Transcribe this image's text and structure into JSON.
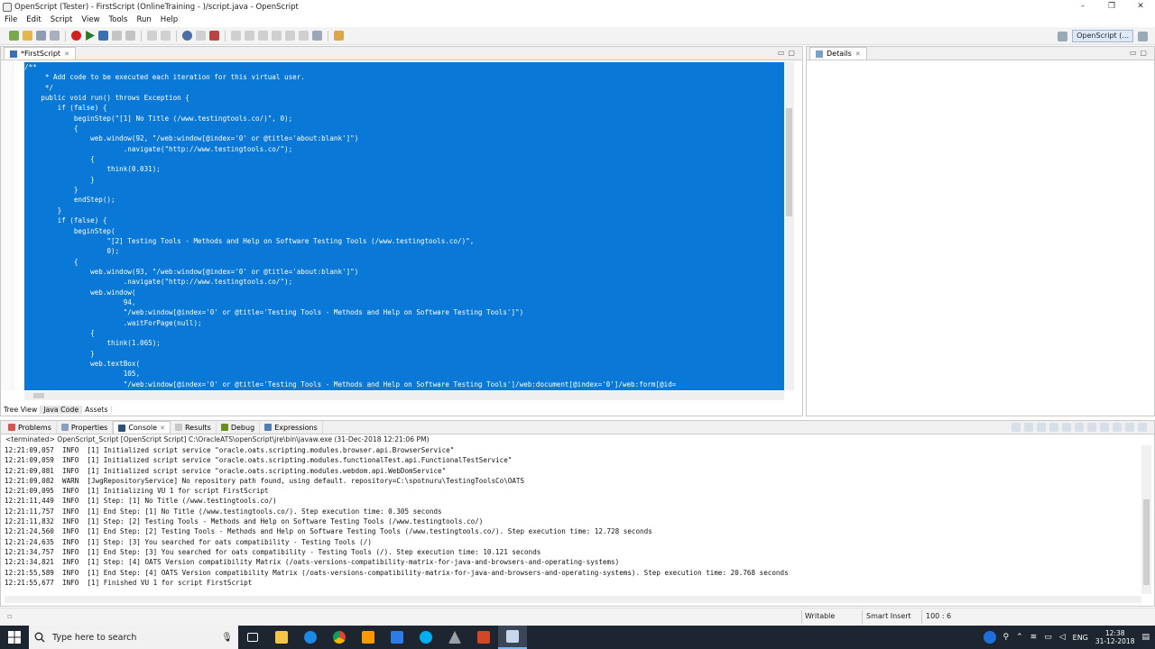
{
  "window": {
    "title": "OpenScript (Tester) - FirstScript (OnlineTraining - )/script.java - OpenScript",
    "controls": [
      "–",
      "❐",
      "✕"
    ]
  },
  "menu": [
    "File",
    "Edit",
    "Script",
    "View",
    "Tools",
    "Run",
    "Help"
  ],
  "toolbar": {
    "perspective_label": "OpenScript (..."
  },
  "editor": {
    "tab_label": "*FirstScript",
    "lines": [
      "/**",
      "     * Add code to be executed each iteration for this virtual user.",
      "     */",
      "    public void run() throws Exception {",
      "        if (false) {",
      "            beginStep(\"[1] No Title (/www.testingtools.co/)\", 0);",
      "            {",
      "                web.window(92, \"/web:window[@index='0' or @title='about:blank']\")",
      "                        .navigate(\"http://www.testingtools.co/\");",
      "                {",
      "                    think(0.031);",
      "                }",
      "            }",
      "            endStep();",
      "        }",
      "        if (false) {",
      "            beginStep(",
      "                    \"[2] Testing Tools - Methods and Help on Software Testing Tools (/www.testingtools.co/)\",",
      "                    0);",
      "            {",
      "                web.window(93, \"/web:window[@index='0' or @title='about:blank']\")",
      "                        .navigate(\"http://www.testingtools.co/\");",
      "                web.window(",
      "                        94,",
      "                        \"/web:window[@index='0' or @title='Testing Tools - Methods and Help on Software Testing Tools']\")",
      "                        .waitForPage(null);",
      "                {",
      "                    think(1.065);",
      "                }",
      "                web.textBox(",
      "                        105,",
      "                        \"/web:window[@index='0' or @title='Testing Tools - Methods and Help on Software Testing Tools']/web:document[@index='0']/web:form[@id="
    ],
    "bottom_tabs": [
      "Tree View",
      "Java Code",
      "Assets"
    ]
  },
  "details": {
    "tab_label": "Details"
  },
  "console": {
    "tabs": [
      "Problems",
      "Properties",
      "Console",
      "Results",
      "Debug",
      "Expressions"
    ],
    "terminated": "<terminated> OpenScript_Script [OpenScript Script] C:\\OracleATS\\openScript\\jre\\bin\\javaw.exe (31-Dec-2018 12:21:06 PM)",
    "lines": [
      "12:21:09,057  INFO  [1] Initialized script service \"oracle.oats.scripting.modules.browser.api.BrowserService\"",
      "12:21:09,059  INFO  [1] Initialized script service \"oracle.oats.scripting.modules.functionalTest.api.FunctionalTestService\"",
      "12:21:09,081  INFO  [1] Initialized script service \"oracle.oats.scripting.modules.webdom.api.WebDomService\"",
      "12:21:09,082  WARN  [JwgRepositoryService] No repository path found, using default. repository=C:\\spotnuru\\TestingToolsCo\\OATS",
      "12:21:09,095  INFO  [1] Initializing VU 1 for script FirstScript",
      "12:21:11,449  INFO  [1] Step: [1] No Title (/www.testingtools.co/)",
      "12:21:11,757  INFO  [1] End Step: [1] No Title (/www.testingtools.co/). Step execution time: 0.305 seconds",
      "12:21:11,832  INFO  [1] Step: [2] Testing Tools - Methods and Help on Software Testing Tools (/www.testingtools.co/)",
      "12:21:24,560  INFO  [1] End Step: [2] Testing Tools - Methods and Help on Software Testing Tools (/www.testingtools.co/). Step execution time: 12.728 seconds",
      "12:21:24,635  INFO  [1] Step: [3] You searched for oats compatibility - Testing Tools (/)",
      "12:21:34,757  INFO  [1] End Step: [3] You searched for oats compatibility - Testing Tools (/). Step execution time: 10.121 seconds",
      "12:21:34,821  INFO  [1] Step: [4] OATS Version compatibility Matrix (/oats-versions-compatibility-matrix-for-java-and-browsers-and-operating-systems)",
      "12:21:55,589  INFO  [1] End Step: [4] OATS Version compatibility Matrix (/oats-versions-compatibility-matrix-for-java-and-browsers-and-operating-systems). Step execution time: 20.768 seconds",
      "12:21:55,677  INFO  [1] Finished VU 1 for script FirstScript"
    ]
  },
  "status": {
    "writable": "Writable",
    "insert_mode": "Smart Insert",
    "position": "100 : 6"
  },
  "taskbar": {
    "search_placeholder": "Type here to search",
    "language": "ENG",
    "time": "12:38",
    "date": "31-12-2018"
  },
  "colors": {
    "selection": "#0a78d7",
    "taskbar": "#1c2530"
  }
}
